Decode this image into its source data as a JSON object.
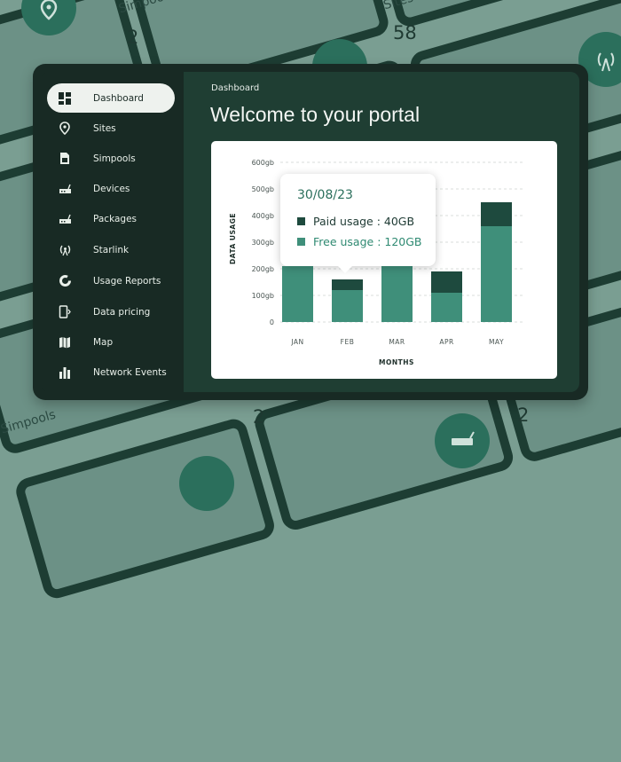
{
  "background": {
    "cards": [
      {
        "label": "Simpools",
        "value": "2"
      },
      {
        "label": "Sites",
        "value": "58"
      },
      {
        "label": "Simpools",
        "value": "2"
      },
      {
        "label": "",
        "value": "2"
      },
      {
        "label": "",
        "value": "2"
      }
    ]
  },
  "sidebar": {
    "items": [
      {
        "label": "Dashboard",
        "icon": "dashboard-icon",
        "active": true
      },
      {
        "label": "Sites",
        "icon": "location-pin-icon"
      },
      {
        "label": "Simpools",
        "icon": "sim-card-icon"
      },
      {
        "label": "Devices",
        "icon": "router-icon"
      },
      {
        "label": "Packages",
        "icon": "router-icon"
      },
      {
        "label": "Starlink",
        "icon": "antenna-icon"
      },
      {
        "label": "Usage Reports",
        "icon": "donut-icon"
      },
      {
        "label": "Data pricing",
        "icon": "phone-data-icon"
      },
      {
        "label": "Map",
        "icon": "map-icon"
      },
      {
        "label": "Network Events",
        "icon": "bar-chart-icon"
      }
    ]
  },
  "header": {
    "breadcrumb": "Dashboard",
    "title": "Welcome to your portal"
  },
  "colors": {
    "paid": "#1e4a3e",
    "free": "#3f8f7a",
    "accent": "#2b6f5c"
  },
  "chart_data": {
    "type": "bar",
    "stacked": true,
    "categories": [
      "JAN",
      "FEB",
      "MAR",
      "APR",
      "MAY"
    ],
    "series": [
      {
        "name": "Free usage",
        "values": [
          210,
          120,
          210,
          110,
          360
        ]
      },
      {
        "name": "Paid usage",
        "values": [
          0,
          40,
          0,
          80,
          90
        ]
      }
    ],
    "yticks": [
      "0",
      "100gb",
      "200gb",
      "300gb",
      "400gb",
      "500gb",
      "600gb"
    ],
    "ylim": [
      0,
      600
    ],
    "xlabel": "MONTHS",
    "ylabel": "DATA USAGE",
    "tooltip": {
      "date": "30/08/23",
      "paid": "Paid usage : 40GB",
      "free": "Free usage : 120GB"
    }
  }
}
